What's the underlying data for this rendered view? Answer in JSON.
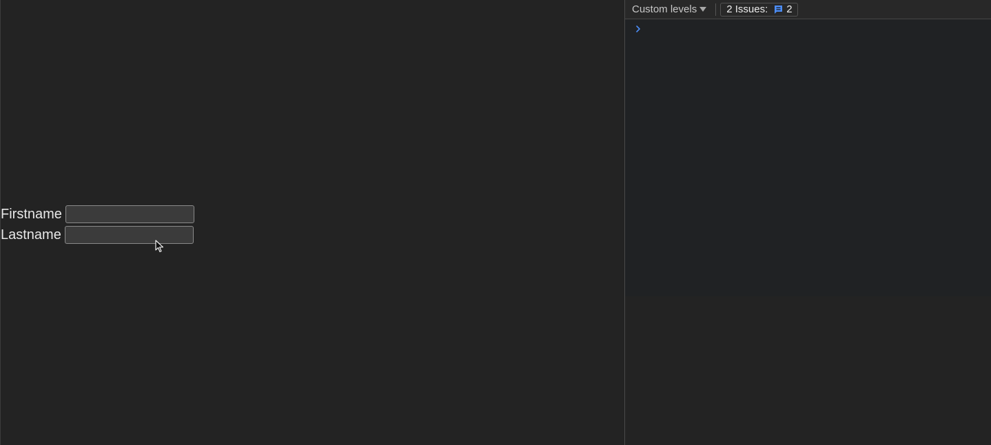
{
  "page": {
    "form": {
      "firstname_label": "Firstname",
      "firstname_value": "",
      "lastname_label": "Lastname",
      "lastname_value": ""
    }
  },
  "devtools": {
    "toolbar": {
      "levels_label": "Custom levels",
      "issues_label": "2 Issues:",
      "issues_count": "2"
    },
    "console": {
      "prompt_icon": "chevron-right-icon"
    }
  },
  "colors": {
    "background": "#232323",
    "console_background": "#202224",
    "accent_blue": "#4c8df6",
    "text": "#e8e8e8"
  }
}
